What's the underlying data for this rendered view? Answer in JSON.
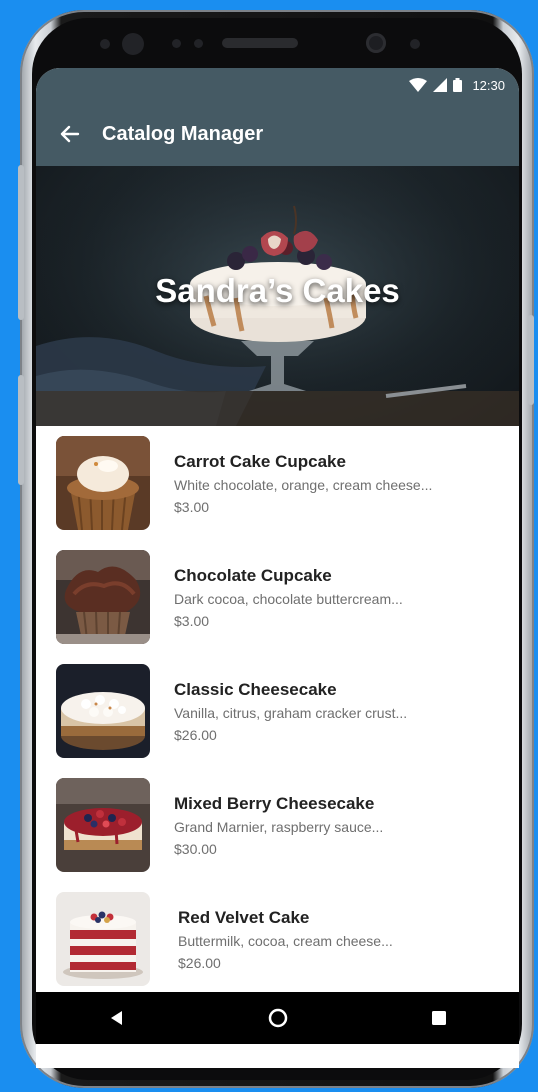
{
  "status_bar": {
    "time": "12:30"
  },
  "app_bar": {
    "title": "Catalog Manager"
  },
  "hero": {
    "shop_name": "Sandra’s Cakes"
  },
  "items": [
    {
      "name": "Carrot Cake Cupcake",
      "description": "White chocolate, orange, cream cheese...",
      "price": "$3.00"
    },
    {
      "name": "Chocolate Cupcake",
      "description": "Dark cocoa, chocolate buttercream...",
      "price": "$3.00"
    },
    {
      "name": "Classic Cheesecake",
      "description": "Vanilla, citrus, graham cracker crust...",
      "price": "$26.00"
    },
    {
      "name": "Mixed Berry Cheesecake",
      "description": "Grand Marnier, raspberry sauce...",
      "price": "$30.00"
    },
    {
      "name": "Red Velvet Cake",
      "description": "Buttermilk, cocoa, cream cheese...",
      "price": "$26.00"
    }
  ],
  "colors": {
    "background": "#1a8ef0",
    "app_bar": "#455a64",
    "nav_bar": "#000000"
  },
  "icons": {
    "back": "arrow-back-icon",
    "wifi": "wifi-icon",
    "signal": "signal-icon",
    "battery": "battery-icon",
    "nav_back": "triangle-back-icon",
    "nav_home": "circle-home-icon",
    "nav_recents": "square-recents-icon"
  }
}
